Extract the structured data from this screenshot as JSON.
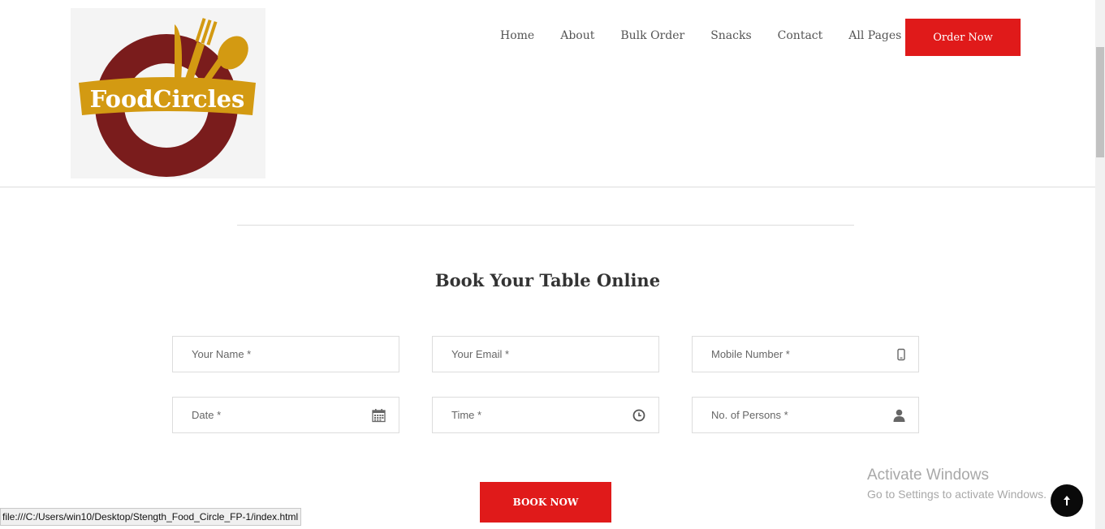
{
  "logo": {
    "text": "FoodCircles"
  },
  "nav": {
    "items": [
      "Home",
      "About",
      "Bulk Order",
      "Snacks",
      "Contact",
      "All Pages"
    ],
    "order_button": "Order Now"
  },
  "booking": {
    "title": "Book Your Table Online",
    "fields": {
      "name": "Your Name *",
      "email": "Your Email *",
      "mobile": "Mobile Number *",
      "date": "Date *",
      "time": "Time *",
      "persons": "No. of Persons *"
    },
    "submit": "BOOK NOW"
  },
  "watermark": {
    "line1": "Activate Windows",
    "line2": "Go to Settings to activate Windows."
  },
  "status_url": "file:///C:/Users/win10/Desktop/Stength_Food_Circle_FP-1/index.html",
  "colors": {
    "accent": "#e01a1a",
    "logo_maroon": "#7a1c1c",
    "logo_gold": "#d39a12"
  }
}
